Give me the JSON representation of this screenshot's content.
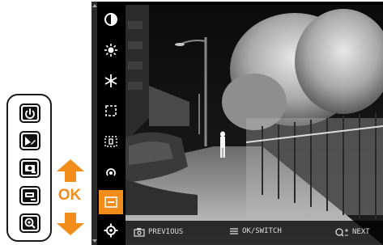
{
  "device": {
    "buttons": [
      {
        "icon": "power-icon"
      },
      {
        "icon": "palette-icon"
      },
      {
        "icon": "camera-icon"
      },
      {
        "icon": "record-icon"
      },
      {
        "icon": "zoom-icon"
      }
    ],
    "ok_label": "OK",
    "accent_color": "#f28c1a"
  },
  "screen": {
    "sidebar": {
      "items": [
        {
          "icon": "contrast-icon"
        },
        {
          "icon": "brightness-icon"
        },
        {
          "icon": "snowflake-icon"
        },
        {
          "icon": "frame-icon"
        },
        {
          "icon": "digital-frame-icon"
        },
        {
          "icon": "signal-icon"
        },
        {
          "icon": "display-icon",
          "active": true
        },
        {
          "icon": "settings-icon"
        }
      ]
    },
    "bottom_bar": {
      "previous_label": "PREVIOUS",
      "switch_label": "OK/SWITCH",
      "next_label": "NEXT"
    }
  }
}
